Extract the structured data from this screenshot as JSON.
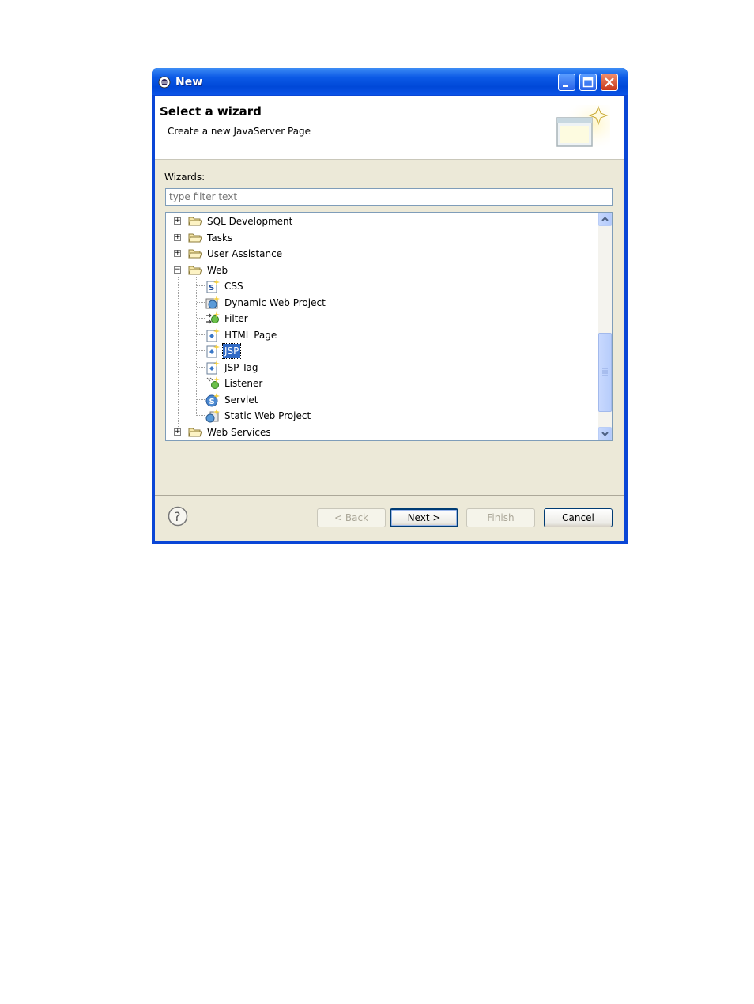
{
  "window": {
    "title": "New"
  },
  "header": {
    "title": "Select a wizard",
    "description": "Create a new JavaServer Page"
  },
  "wizards": {
    "label": "Wizards:",
    "filter_placeholder": "type filter text",
    "tree": [
      {
        "label": "SQL Development",
        "expanded": false
      },
      {
        "label": "Tasks",
        "expanded": false
      },
      {
        "label": "User Assistance",
        "expanded": false
      },
      {
        "label": "Web",
        "expanded": true,
        "children": [
          {
            "label": "CSS",
            "icon": "css-file-icon"
          },
          {
            "label": "Dynamic Web Project",
            "icon": "web-project-icon"
          },
          {
            "label": "Filter",
            "icon": "filter-icon"
          },
          {
            "label": "HTML Page",
            "icon": "html-file-icon"
          },
          {
            "label": "JSP",
            "icon": "jsp-file-icon",
            "selected": true
          },
          {
            "label": "JSP Tag",
            "icon": "jsp-tag-icon"
          },
          {
            "label": "Listener",
            "icon": "listener-icon"
          },
          {
            "label": "Servlet",
            "icon": "servlet-icon"
          },
          {
            "label": "Static Web Project",
            "icon": "static-web-project-icon"
          }
        ]
      },
      {
        "label": "Web Services",
        "expanded": false
      }
    ]
  },
  "buttons": {
    "back": "< Back",
    "next": "Next >",
    "finish": "Finish",
    "cancel": "Cancel"
  },
  "colors": {
    "titlebar": "#0a46d6",
    "selection": "#316ac5",
    "dialog_bg": "#ece9d8"
  }
}
